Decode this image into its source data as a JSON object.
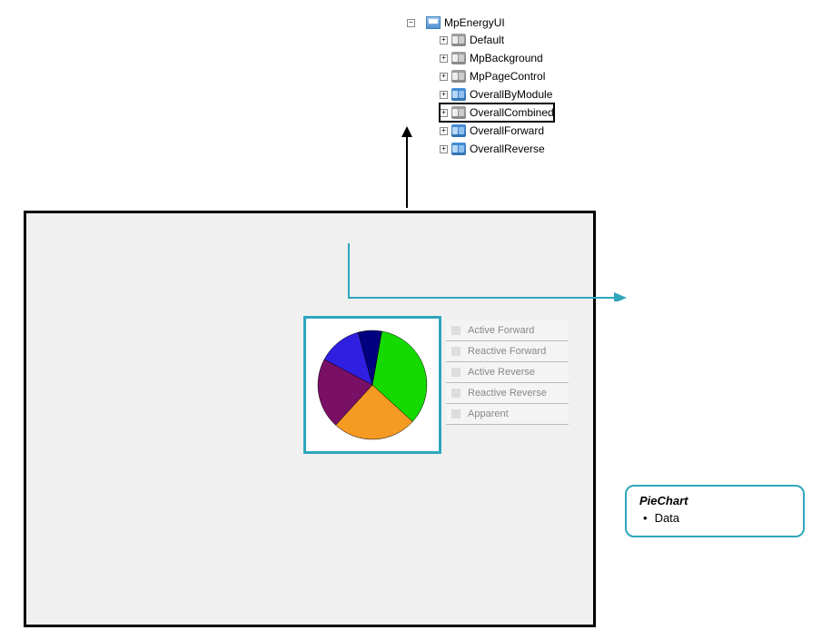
{
  "tree": {
    "root": "MpEnergyUI",
    "items": [
      {
        "label": "Default",
        "iconClass": "struct"
      },
      {
        "label": "MpBackground",
        "iconClass": "struct"
      },
      {
        "label": "MpPageControl",
        "iconClass": "struct"
      },
      {
        "label": "OverallByModule",
        "iconClass": "struct-blue"
      },
      {
        "label": "OverallCombined",
        "iconClass": "struct",
        "highlighted": true
      },
      {
        "label": "OverallForward",
        "iconClass": "struct-blue"
      },
      {
        "label": "OverallReverse",
        "iconClass": "struct-blue"
      }
    ]
  },
  "legend": {
    "items": [
      "Active Forward",
      "Reactive Forward",
      "Active Reverse",
      "Reactive Reverse",
      "Apparent"
    ]
  },
  "callout": {
    "title": "PieChart",
    "bullet": "Data"
  },
  "chart_data": {
    "type": "pie",
    "title": "",
    "slices": [
      {
        "name": "green",
        "color": "#15d900",
        "value": 34
      },
      {
        "name": "orange",
        "color": "#f59a22",
        "value": 25
      },
      {
        "name": "purple",
        "color": "#7a0f66",
        "value": 21
      },
      {
        "name": "blue",
        "color": "#2f1fe0",
        "value": 13
      },
      {
        "name": "navy",
        "color": "#000080",
        "value": 7
      }
    ]
  }
}
